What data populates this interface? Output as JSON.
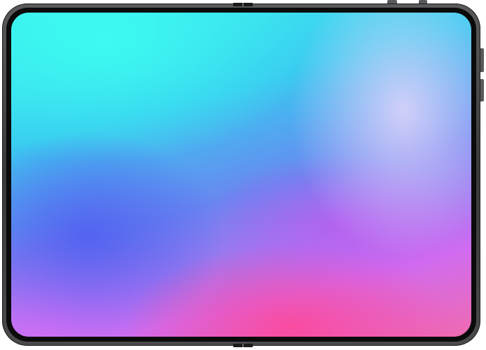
{
  "device": {
    "type": "tablet",
    "frame_color": "#3a3a3c",
    "bezel_color": "#0b0b0c"
  },
  "wallpaper": {
    "style": "gradient",
    "colors": [
      "#3ef0ee",
      "#39c9f0",
      "#5064f0",
      "#d06cf0",
      "#f04696",
      "#e6d7fa"
    ]
  }
}
